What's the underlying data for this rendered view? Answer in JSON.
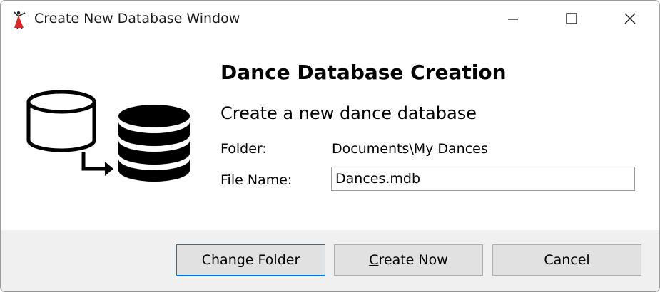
{
  "window": {
    "title": "Create New Database Window",
    "app_icon": "dancer-icon"
  },
  "titlebar_controls": {
    "minimize_icon": "minimize-icon",
    "maximize_icon": "maximize-icon",
    "close_icon": "close-icon"
  },
  "main": {
    "heading": "Dance Database Creation",
    "subheading": "Create a new dance database",
    "folder_label": "Folder:",
    "folder_value": "Documents\\My Dances",
    "filename_label": "File Name:",
    "filename_value": "Dances.mdb",
    "graphic_icon": "database-copy-icon"
  },
  "buttons": {
    "change_folder": "Change Folder",
    "create_now_mnemonic": "C",
    "create_now_rest": "reate Now",
    "cancel": "Cancel"
  },
  "colors": {
    "accent": "#0078d7",
    "app_icon_red": "#d62a2a",
    "footer_bg": "#f0f0f0",
    "button_bg": "#e1e1e1"
  }
}
